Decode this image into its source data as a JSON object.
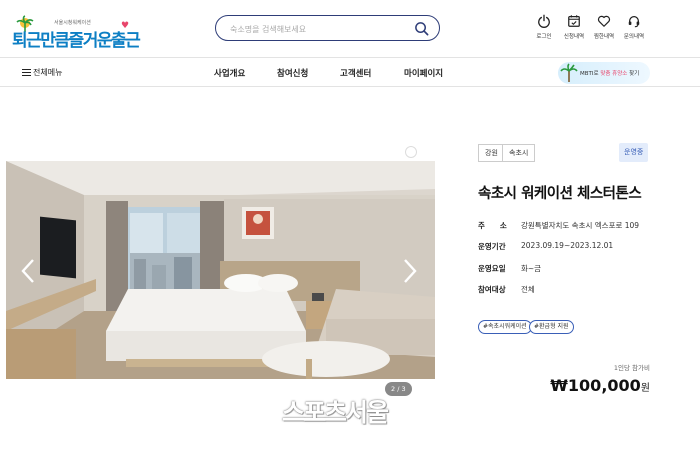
{
  "header": {
    "logo_sub": "서울시청워케이션",
    "logo_text": "퇴근만큼즐거운출근",
    "search_placeholder": "숙소명을 검색해보세요",
    "utils": [
      {
        "label": "로그인",
        "icon": "power-icon"
      },
      {
        "label": "신청내역",
        "icon": "calendar-check-icon"
      },
      {
        "label": "찜한내역",
        "icon": "heart-icon"
      },
      {
        "label": "문의내역",
        "icon": "headset-icon"
      }
    ]
  },
  "nav": {
    "all_menu": "전체메뉴",
    "items": [
      "사업개요",
      "참여신청",
      "고객센터",
      "마이페이지"
    ],
    "mbti_prefix": "MBTI로",
    "mbti_highlight": "맞춤 휴양소",
    "mbti_suffix": "찾기"
  },
  "gallery": {
    "counter": "2 / 3",
    "watermark": "스포츠서울"
  },
  "detail": {
    "tags": [
      "강원",
      "속초시"
    ],
    "status": "운영중",
    "title": "속초시 워케이션 체스터톤스",
    "info": [
      {
        "label": "주　　소",
        "value": "강원특별자치도 속초시 엑스포로 109"
      },
      {
        "label": "운영기간",
        "value": "2023.09.19~2023.12.01"
      },
      {
        "label": "운영요일",
        "value": "화~금"
      },
      {
        "label": "참여대상",
        "value": "전체"
      }
    ],
    "hashtags": [
      "#속초시워케이션",
      "#환급형 지원"
    ],
    "price_label": "1인당 참가비",
    "price": "₩100,000",
    "price_unit": "원"
  },
  "colors": {
    "accent": "#2e3d78",
    "status_bg": "#e3ecfb",
    "status_text": "#3a5fb7"
  }
}
